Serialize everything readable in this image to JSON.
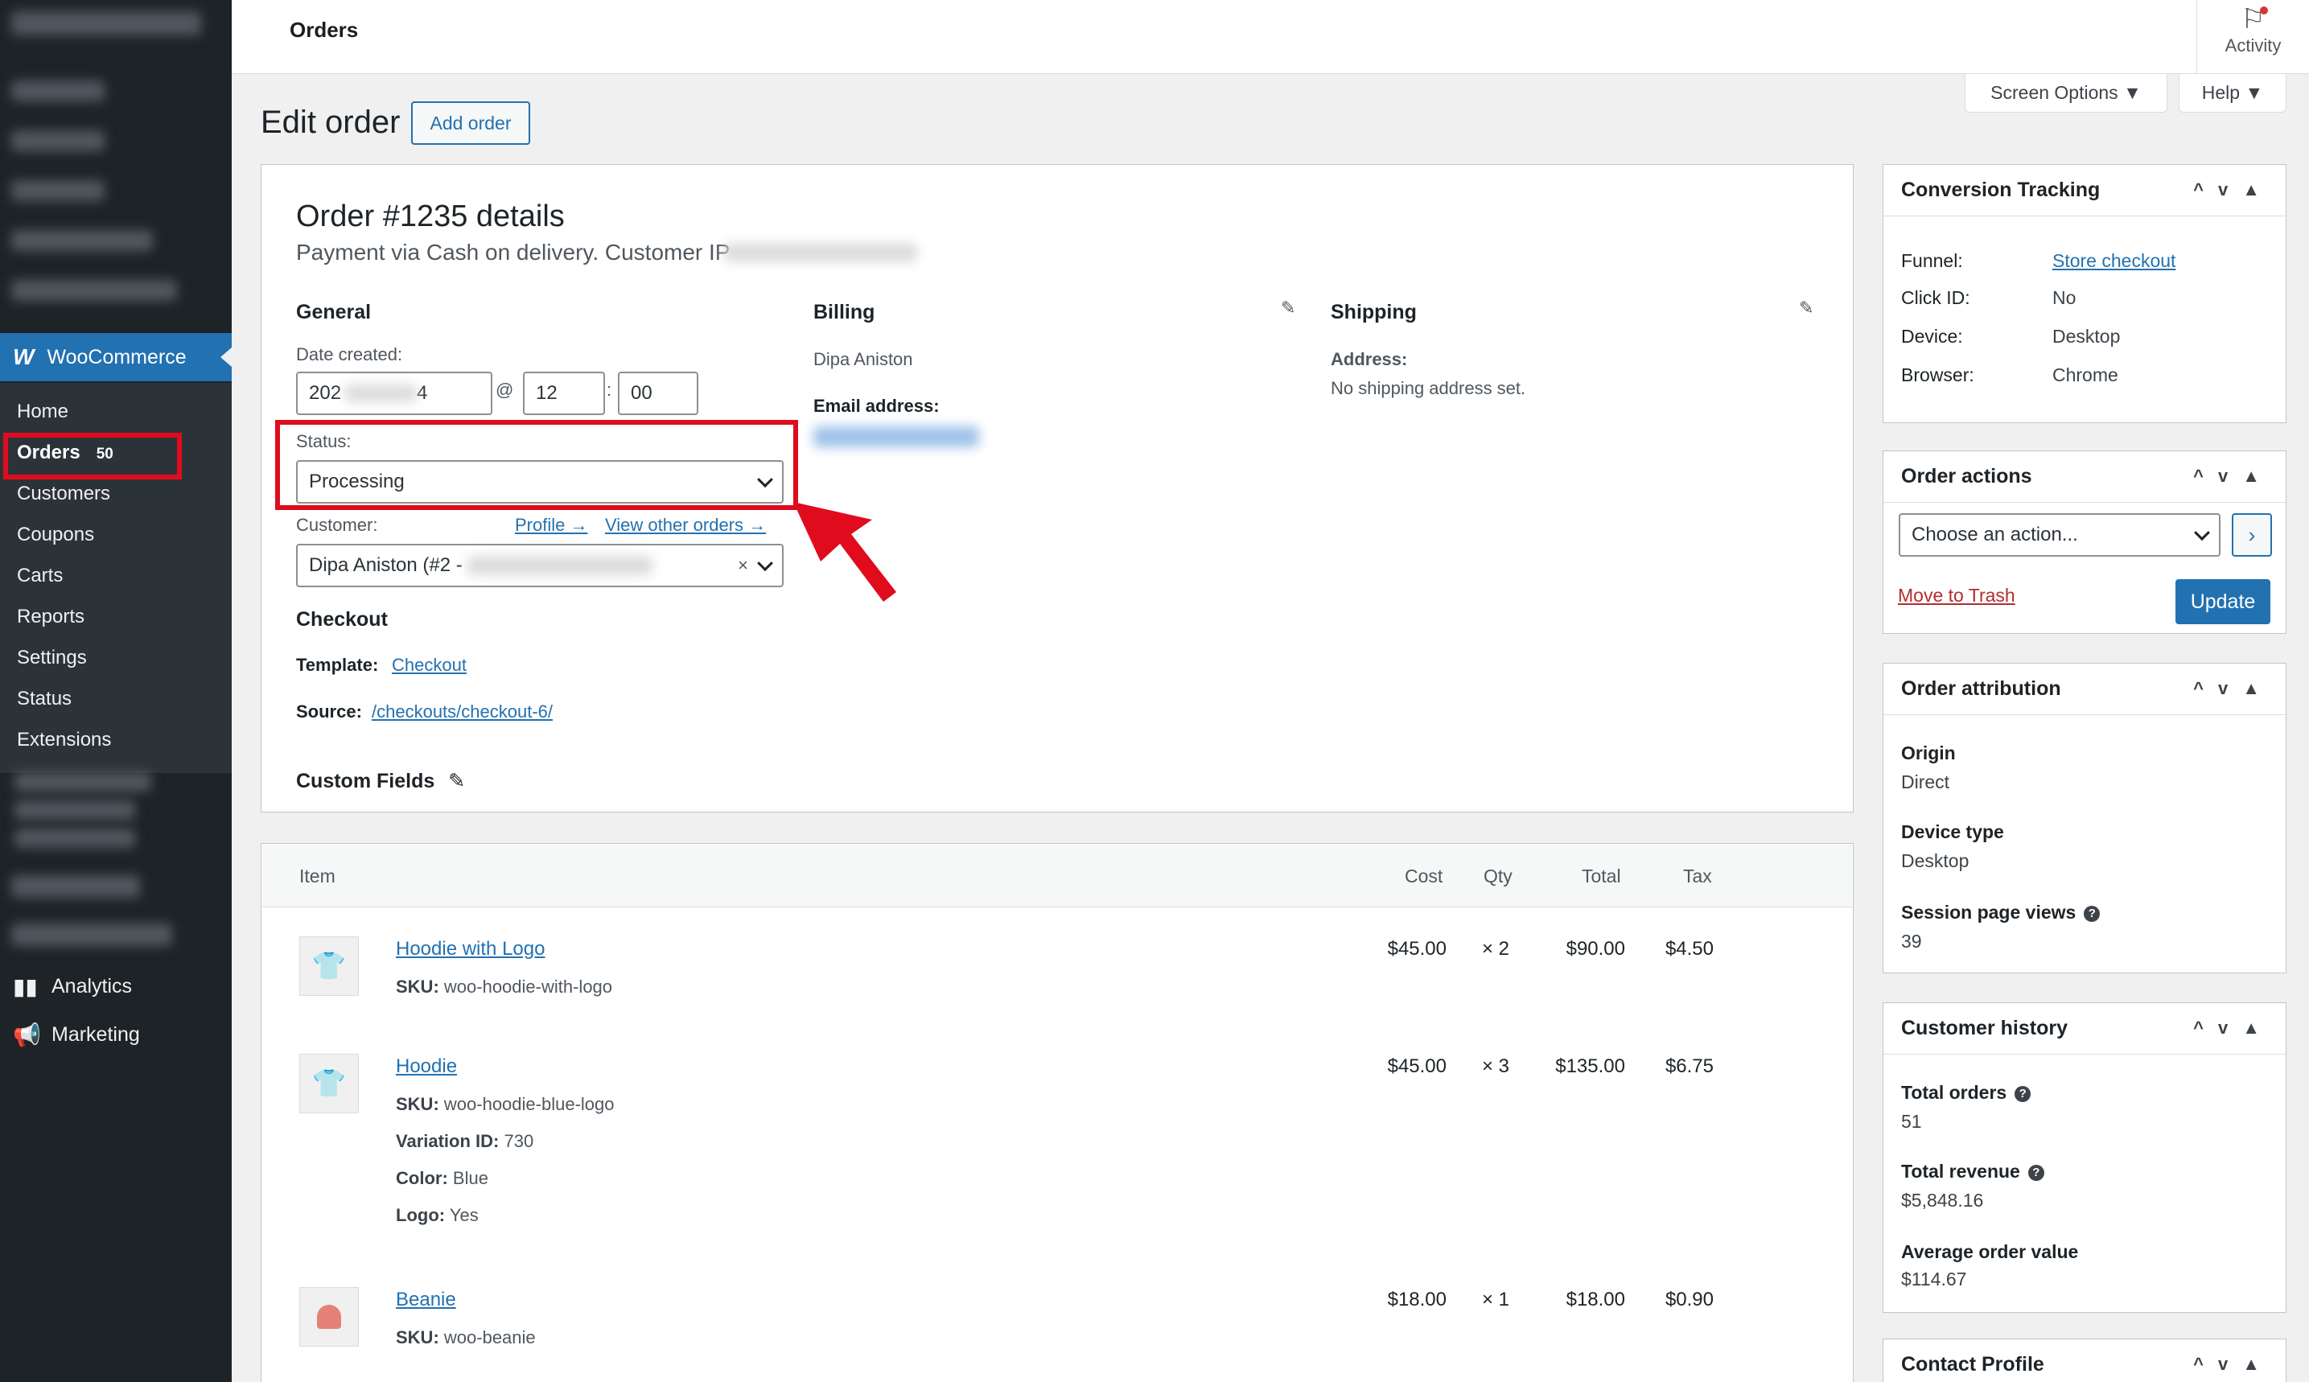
{
  "sidebar": {
    "woocommerce_label": "WooCommerce",
    "woocommerce_logo": "W",
    "submenu": [
      {
        "label": "Home"
      },
      {
        "label": "Orders",
        "count": "50"
      },
      {
        "label": "Customers"
      },
      {
        "label": "Coupons"
      },
      {
        "label": "Carts"
      },
      {
        "label": "Reports"
      },
      {
        "label": "Settings"
      },
      {
        "label": "Status"
      },
      {
        "label": "Extensions"
      }
    ],
    "analytics_label": "Analytics",
    "marketing_label": "Marketing"
  },
  "topbar": {
    "title": "Orders",
    "activity_label": "Activity"
  },
  "screen_options_label": "Screen Options ▼",
  "help_label": "Help ▼",
  "page_title": "Edit order",
  "add_order_label": "Add order",
  "order": {
    "heading": "Order #1235 details",
    "subheading": "Payment via Cash on delivery. Customer IP",
    "general": {
      "title": "General",
      "date_label": "Date created:",
      "date_value": "202",
      "date_tail": "4",
      "at": "@",
      "hour": "12",
      "colon": ":",
      "minute": "00",
      "status_label": "Status:",
      "status_value": "Processing",
      "customer_label": "Customer:",
      "profile_link": "Profile →",
      "view_orders_link": "View other orders →",
      "customer_value": "Dipa Aniston (#2 -",
      "clear_icon": "×"
    },
    "billing": {
      "title": "Billing",
      "name": "Dipa Aniston",
      "email_label": "Email address:"
    },
    "shipping": {
      "title": "Shipping",
      "address_label": "Address:",
      "address_value": "No shipping address set."
    },
    "checkout": {
      "title": "Checkout",
      "template_label": "Template:",
      "template_link": "Checkout",
      "source_label": "Source:",
      "source_link": "/checkouts/checkout-6/"
    },
    "custom_fields_label": "Custom Fields"
  },
  "items_table": {
    "headers": {
      "item": "Item",
      "cost": "Cost",
      "qty": "Qty",
      "total": "Total",
      "tax": "Tax"
    },
    "rows": [
      {
        "name": "Hoodie with Logo",
        "sku_label": "SKU:",
        "sku": "woo-hoodie-with-logo",
        "cost": "$45.00",
        "qty": "× 2",
        "total": "$90.00",
        "tax": "$4.50"
      },
      {
        "name": "Hoodie",
        "sku_label": "SKU:",
        "sku": "woo-hoodie-blue-logo",
        "variation_label": "Variation ID:",
        "variation": "730",
        "color_label": "Color:",
        "color": "Blue",
        "logo_label": "Logo:",
        "logo": "Yes",
        "cost": "$45.00",
        "qty": "× 3",
        "total": "$135.00",
        "tax": "$6.75"
      },
      {
        "name": "Beanie",
        "sku_label": "SKU:",
        "sku": "woo-beanie",
        "cost": "$18.00",
        "qty": "× 1",
        "total": "$18.00",
        "tax": "$0.90"
      }
    ]
  },
  "conversion_tracking": {
    "title": "Conversion Tracking",
    "rows": [
      {
        "label": "Funnel:",
        "value": "Store checkout"
      },
      {
        "label": "Click ID:",
        "value": "No"
      },
      {
        "label": "Device:",
        "value": "Desktop"
      },
      {
        "label": "Browser:",
        "value": "Chrome"
      }
    ]
  },
  "order_actions": {
    "title": "Order actions",
    "select_value": "Choose an action...",
    "go_icon": "›",
    "trash_label": "Move to Trash",
    "update_label": "Update"
  },
  "order_attribution": {
    "title": "Order attribution",
    "origin_label": "Origin",
    "origin_value": "Direct",
    "device_label": "Device type",
    "device_value": "Desktop",
    "views_label": "Session page views",
    "views_value": "39"
  },
  "customer_history": {
    "title": "Customer history",
    "orders_label": "Total orders",
    "orders_value": "51",
    "revenue_label": "Total revenue",
    "revenue_value": "$5,848.16",
    "aov_label": "Average order value",
    "aov_value": "$114.67"
  },
  "contact_profile": {
    "title": "Contact Profile"
  },
  "box_controls": {
    "up": "^",
    "down": "v",
    "toggle": "▲"
  },
  "help_icon": "?",
  "colors": {
    "accent": "#2271b1",
    "sidebar": "#1d2327",
    "highlight": "#e10b1e"
  }
}
